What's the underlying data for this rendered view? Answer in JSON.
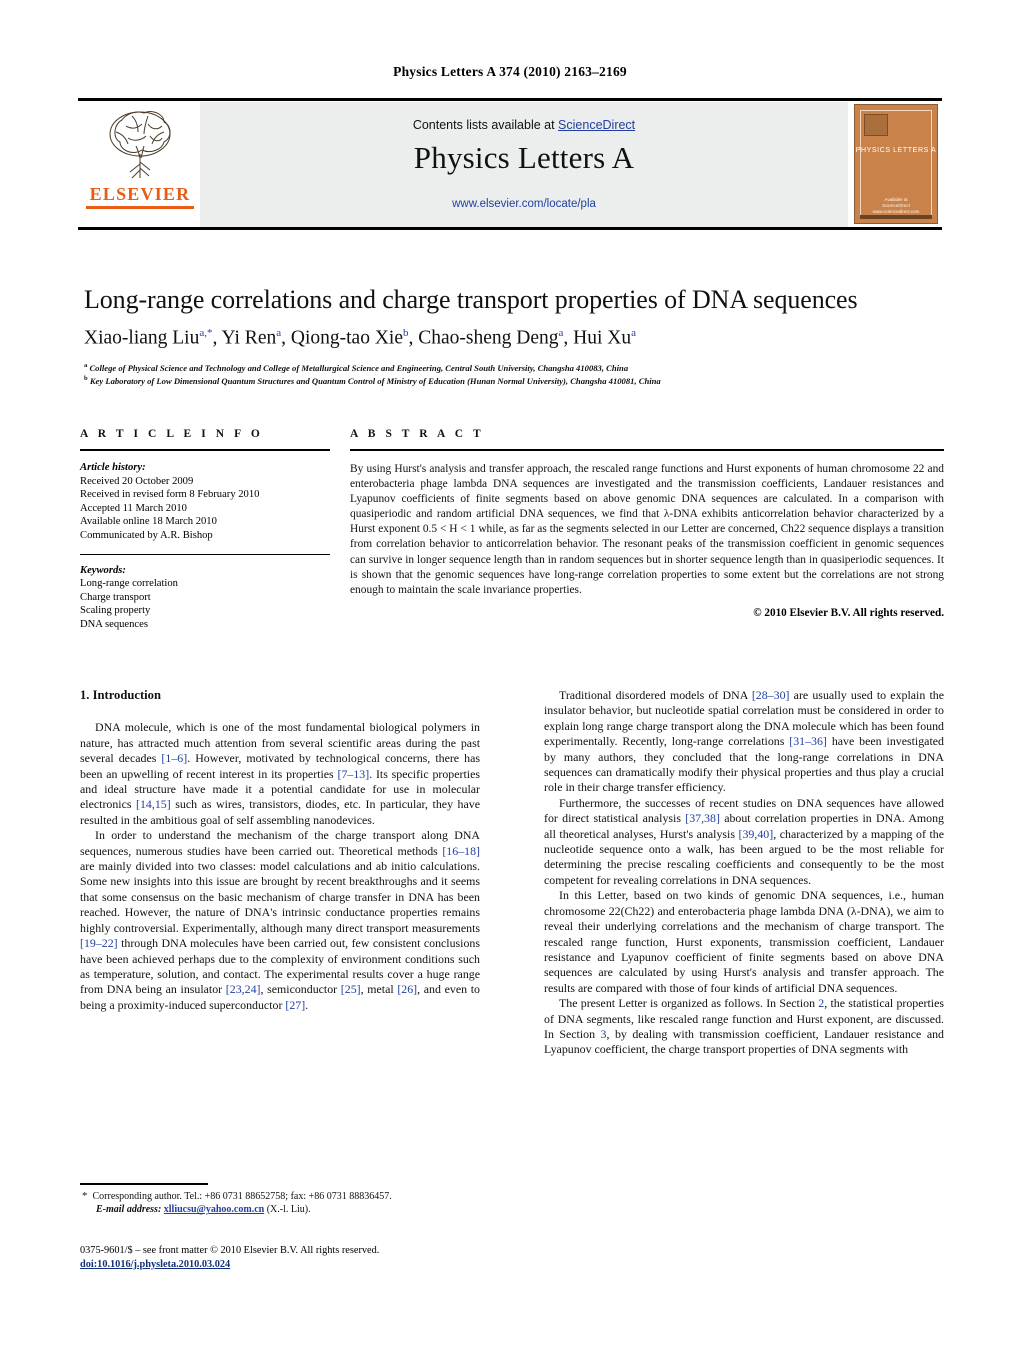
{
  "running_head": "Physics Letters A 374 (2010) 2163–2169",
  "masthead": {
    "contents_prefix": "Contents lists available at ",
    "sciencedirect": "ScienceDirect",
    "journal_title": "Physics Letters A",
    "journal_url": "www.elsevier.com/locate/pla",
    "publisher_word": "ELSEVIER",
    "cover_title": "PHYSICS LETTERS A",
    "cover_footer_line1": "Available at",
    "cover_footer_line2": "ScienceDirect",
    "cover_footer_line3": "www.sciencedirect.com",
    "accent_color": "#e85c13",
    "link_color": "#2340a0"
  },
  "article": {
    "title": "Long-range correlations and charge transport properties of DNA sequences",
    "authors_html": "Xiao-liang Liu<sup>a,*</sup>, Yi Ren<sup>a</sup>, Qiong-tao Xie<sup>b</sup>, Chao-sheng Deng<sup>a</sup>, Hui Xu<sup>a</sup>",
    "affiliation_a": "College of Physical Science and Technology and College of Metallurgical Science and Engineering, Central South University, Changsha 410083, China",
    "affiliation_b": "Key Laboratory of Low Dimensional Quantum Structures and Quantum Control of Ministry of Education (Hunan Normal University), Changsha 410081, China"
  },
  "info": {
    "heading": "A R T I C L E   I N F O",
    "history_label": "Article history:",
    "history": [
      "Received 20 October 2009",
      "Received in revised form 8 February 2010",
      "Accepted 11 March 2010",
      "Available online 18 March 2010",
      "Communicated by A.R. Bishop"
    ],
    "keywords_label": "Keywords:",
    "keywords": [
      "Long-range correlation",
      "Charge transport",
      "Scaling property",
      "DNA sequences"
    ]
  },
  "abstract": {
    "heading": "A B S T R A C T",
    "text": "By using Hurst's analysis and transfer approach, the rescaled range functions and Hurst exponents of human chromosome 22 and enterobacteria phage lambda DNA sequences are investigated and the transmission coefficients, Landauer resistances and Lyapunov coefficients of finite segments based on above genomic DNA sequences are calculated. In a comparison with quasiperiodic and random artificial DNA sequences, we find that λ-DNA exhibits anticorrelation behavior characterized by a Hurst exponent 0.5 < H < 1 while, as far as the segments selected in our Letter are concerned, Ch22 sequence displays a transition from correlation behavior to anticorrelation behavior. The resonant peaks of the transmission coefficient in genomic sequences can survive in longer sequence length than in random sequences but in shorter sequence length than in quasiperiodic sequences. It is shown that the genomic sequences have long-range correlation properties to some extent but the correlations are not strong enough to maintain the scale invariance properties.",
    "copyright": "© 2010 Elsevier B.V. All rights reserved."
  },
  "body": {
    "section1_heading": "1. Introduction",
    "left_paragraphs": [
      "DNA molecule, which is one of the most fundamental biological polymers in nature, has attracted much attention from several scientific areas during the past several decades [1–6]. However, motivated by technological concerns, there has been an upwelling of recent interest in its properties [7–13]. Its specific properties and ideal structure have made it a potential candidate for use in molecular electronics [14,15] such as wires, transistors, diodes, etc. In particular, they have resulted in the ambitious goal of self assembling nanodevices.",
      "In order to understand the mechanism of the charge transport along DNA sequences, numerous studies have been carried out. Theoretical methods [16–18] are mainly divided into two classes: model calculations and ab initio calculations. Some new insights into this issue are brought by recent breakthroughs and it seems that some consensus on the basic mechanism of charge transfer in DNA has been reached. However, the nature of DNA's intrinsic conductance properties remains highly controversial. Experimentally, although many direct transport measurements [19–22] through DNA molecules have been carried out, few consistent conclusions have been achieved perhaps due to the complexity of environment conditions such as temperature, solution, and contact. The experimental results cover a huge range from DNA being an insulator [23,24], semiconductor [25], metal [26], and even to being a proximity-induced superconductor [27]."
    ],
    "right_paragraphs": [
      "Traditional disordered models of DNA [28–30] are usually used to explain the insulator behavior, but nucleotide spatial correlation must be considered in order to explain long range charge transport along the DNA molecule which has been found experimentally. Recently, long-range correlations [31–36] have been investigated by many authors, they concluded that the long-range correlations in DNA sequences can dramatically modify their physical properties and thus play a crucial role in their charge transfer efficiency.",
      "Furthermore, the successes of recent studies on DNA sequences have allowed for direct statistical analysis [37,38] about correlation properties in DNA. Among all theoretical analyses, Hurst's analysis [39,40], characterized by a mapping of the nucleotide sequence onto a walk, has been argued to be the most reliable for determining the precise rescaling coefficients and consequently to be the most competent for revealing correlations in DNA sequences.",
      "In this Letter, based on two kinds of genomic DNA sequences, i.e., human chromosome 22(Ch22) and enterobacteria phage lambda DNA (λ-DNA), we aim to reveal their underlying correlations and the mechanism of charge transport. The rescaled range function, Hurst exponents, transmission coefficient, Landauer resistance and Lyapunov coefficient of finite segments based on above DNA sequences are calculated by using Hurst's analysis and transfer approach. The results are compared with those of four kinds of artificial DNA sequences.",
      "The present Letter is organized as follows. In Section 2, the statistical properties of DNA segments, like rescaled range function and Hurst exponent, are discussed. In Section 3, by dealing with transmission coefficient, Landauer resistance and Lyapunov coefficient, the charge transport properties of DNA segments with"
    ]
  },
  "footnotes": {
    "corresponding": "Corresponding author. Tel.: +86 0731 88652758; fax: +86 0731 88836457.",
    "email_label": "E-mail address:",
    "email": "xlliucsu@yahoo.com.cn",
    "email_owner": "(X.-l. Liu).",
    "imprint": "0375-9601/$ – see front matter  © 2010 Elsevier B.V. All rights reserved.",
    "doi": "doi:10.1016/j.physleta.2010.03.024"
  }
}
